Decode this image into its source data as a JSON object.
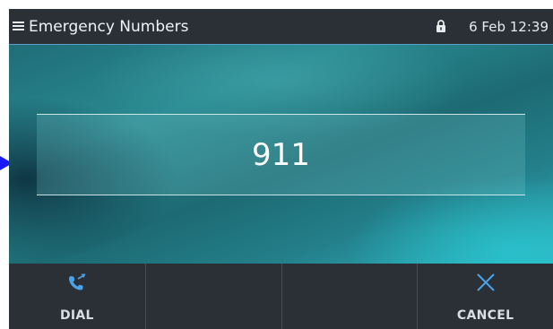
{
  "status_bar": {
    "title": "Emergency Numbers",
    "datetime": "6 Feb 12:39",
    "menu_icon": "hamburger-menu-icon",
    "lock_icon": "lock-icon"
  },
  "main": {
    "number": "911"
  },
  "softkeys": [
    {
      "label": "DIAL",
      "icon": "dial-phone-icon"
    },
    {
      "label": "",
      "icon": ""
    },
    {
      "label": "",
      "icon": ""
    },
    {
      "label": "CANCEL",
      "icon": "close-icon"
    }
  ],
  "colors": {
    "bar_background": "#2b3036",
    "accent_blue": "#4aa3e8",
    "pointer_arrow": "#1a1aff"
  }
}
